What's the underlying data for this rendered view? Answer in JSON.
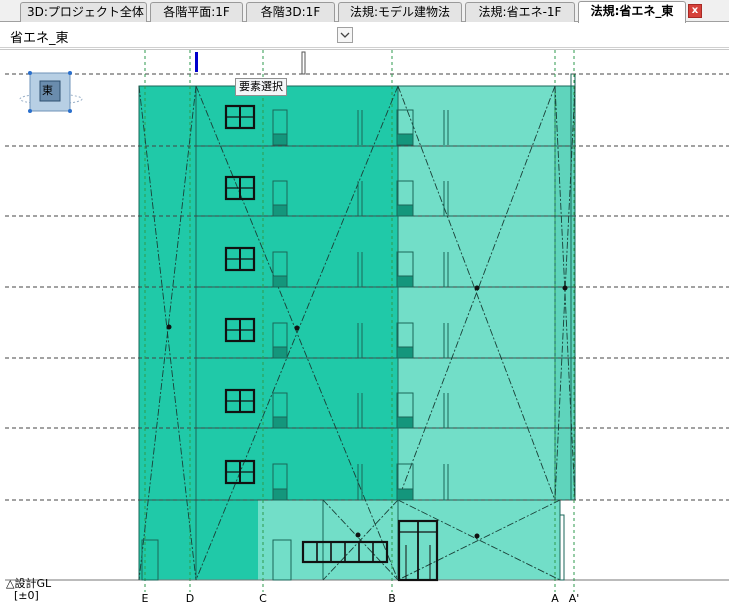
{
  "tabs": [
    {
      "label": "3D:プロジェクト全体"
    },
    {
      "label": "各階平面:1F"
    },
    {
      "label": "各階3D:1F"
    },
    {
      "label": "法規:モデル建物法"
    },
    {
      "label": "法規:省エネ-1F"
    },
    {
      "label": "法規:省エネ_東",
      "active": true
    }
  ],
  "tab_close": "x",
  "view": {
    "name": "省エネ_東"
  },
  "tooltip": "要素選択",
  "view_widget": {
    "label": "東"
  },
  "ground": {
    "label": "△設計GL",
    "value": "[±0]"
  },
  "grid_labels": [
    "E",
    "D",
    "C",
    "B",
    "A",
    "A'"
  ],
  "colors": {
    "facade_dark": "#20c9a8",
    "facade_light": "#72dec8",
    "line_dark": "#1a6658",
    "gridline": "#2e9a4c",
    "level_line": "#444444",
    "accent_marker": "#0000cc"
  }
}
